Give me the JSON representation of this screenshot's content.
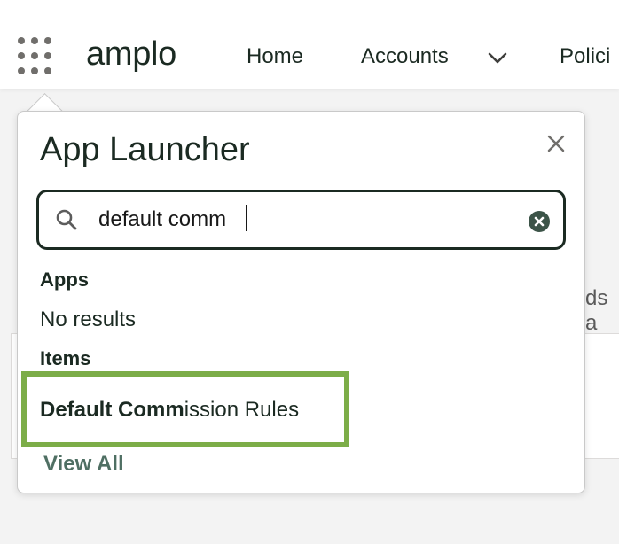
{
  "header": {
    "brand": "amplo",
    "nav": {
      "home": "Home",
      "accounts": "Accounts",
      "policies": "Polici"
    }
  },
  "background": {
    "partial_text": "ds a"
  },
  "launcher": {
    "title": "App Launcher",
    "search": {
      "value": "default comm",
      "icon": "search-icon"
    },
    "apps_heading": "Apps",
    "apps_empty": "No results",
    "items_heading": "Items",
    "result": {
      "match": "Default Comm",
      "rest": "ission Rules"
    },
    "view_all": "View All"
  },
  "colors": {
    "highlight": "#7cad48",
    "accent_text": "#4f6f63",
    "dark": "#1b2a22"
  }
}
